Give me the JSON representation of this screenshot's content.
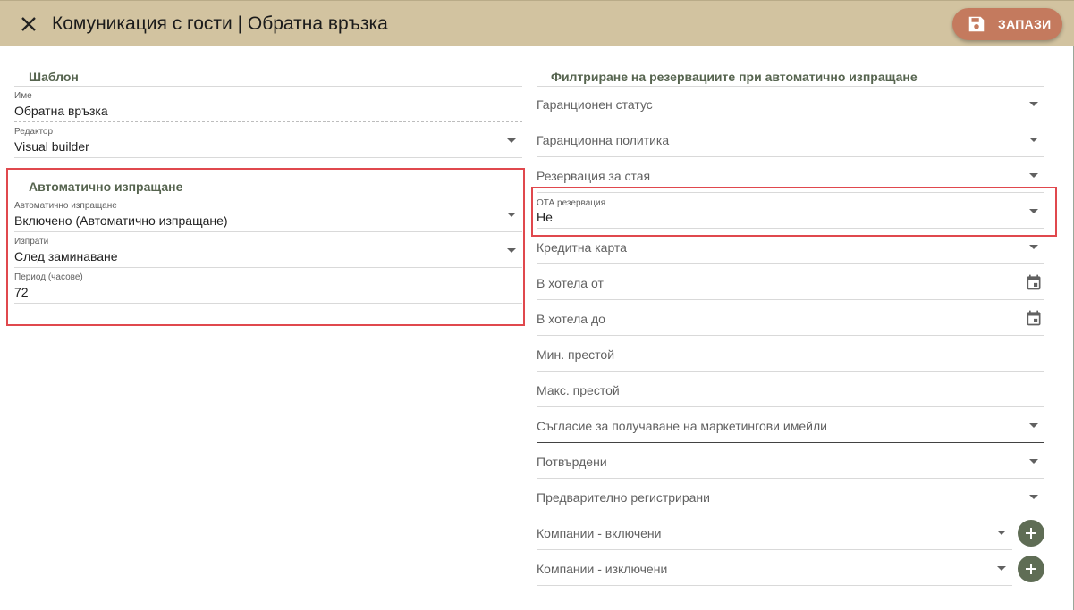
{
  "header": {
    "title": "Комуникация с гости | Обратна връзка",
    "save_label": "ЗАПАЗИ",
    "close_icon": "close-icon",
    "save_icon": "floppy-disk-icon"
  },
  "template_section": {
    "heading": "Шаблон",
    "name": {
      "label": "Име",
      "value": "Обратна връзка"
    },
    "editor": {
      "label": "Редактор",
      "value": "Visual builder"
    }
  },
  "auto_send_section": {
    "heading": "Автоматично изпращане",
    "auto_send": {
      "label": "Автоматично изпращане",
      "value": "Включено (Автоматично изпращане)"
    },
    "send": {
      "label": "Изпрати",
      "value": "След заминаване"
    },
    "period": {
      "label": "Период (часове)",
      "value": "72"
    }
  },
  "filters_section": {
    "heading": "Филтриране на резервациите при автоматично изпращане",
    "items": [
      {
        "label": "Гаранционен статус"
      },
      {
        "label": "Гаранционна политика"
      },
      {
        "label": "Резервация за стая"
      },
      {
        "label": "ОТА резервация",
        "value": "Не"
      },
      {
        "label": "Кредитна карта"
      },
      {
        "label": "В хотела от"
      },
      {
        "label": "В хотела до"
      },
      {
        "label": "Мин. престой"
      },
      {
        "label": "Макс. престой"
      },
      {
        "label": "Съгласие за получаване на маркетингови имейли"
      },
      {
        "label": "Потвърдени"
      },
      {
        "label": "Предварително регистрирани"
      },
      {
        "label": "Компании - включени"
      },
      {
        "label": "Компании - изключени"
      }
    ]
  },
  "colors": {
    "header_bg": "#d2c3a0",
    "save_button": "#c47a5e",
    "heading_text": "#56644f",
    "highlight": "#e0484d",
    "plus_button": "#5f6d55"
  }
}
